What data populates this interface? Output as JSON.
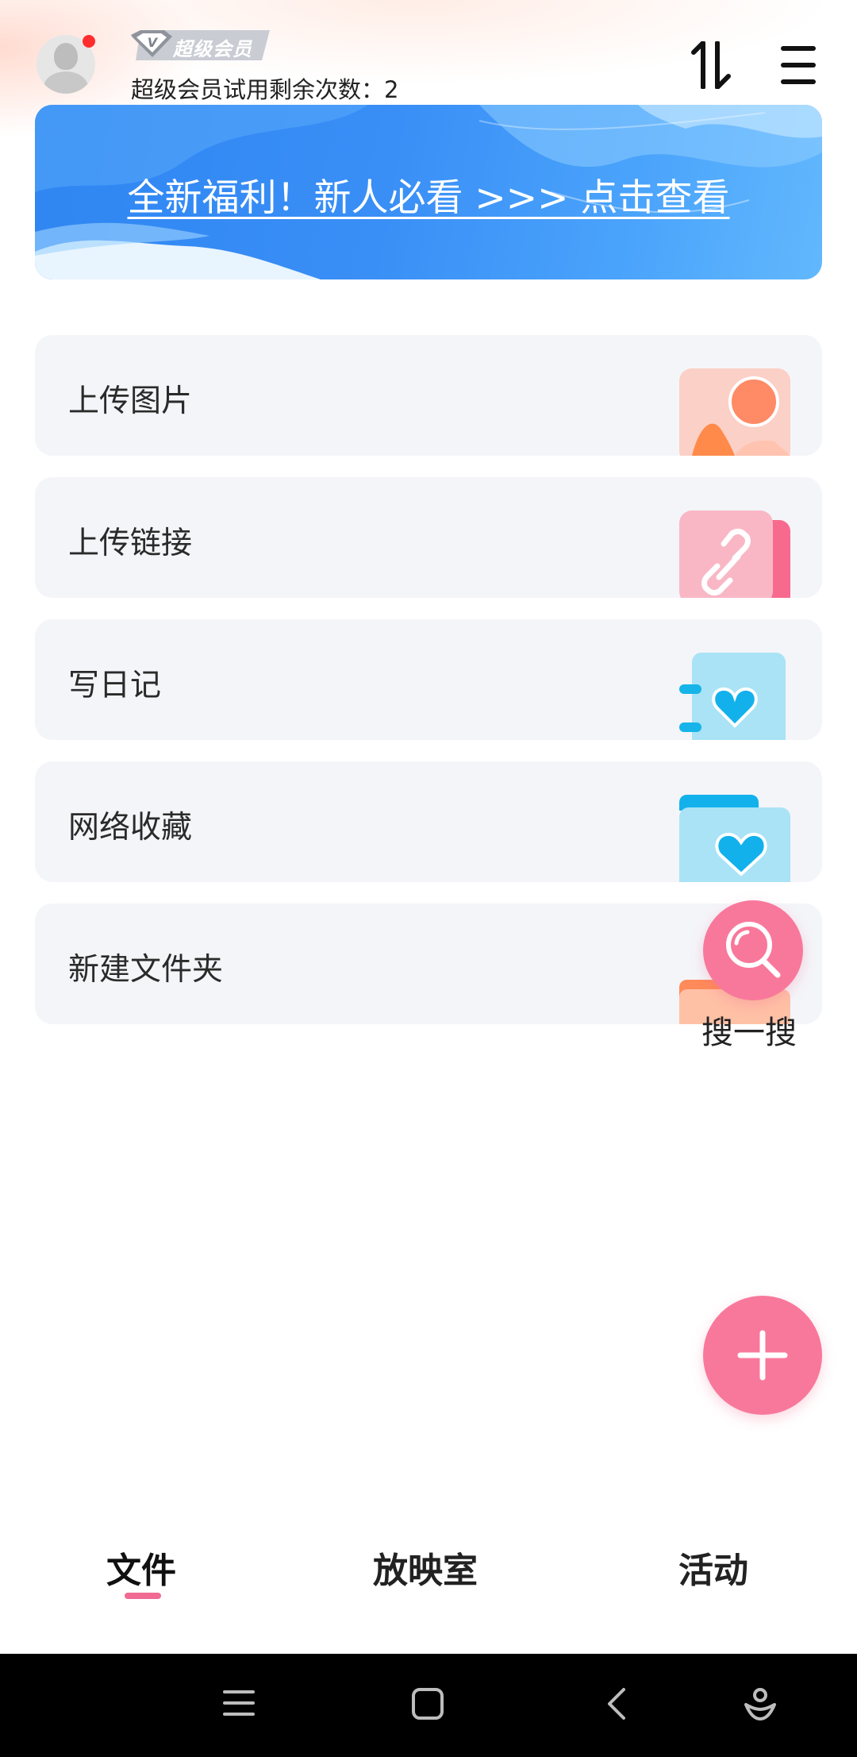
{
  "header": {
    "vip_badge_label": "超级会员",
    "vip_badge_letter": "V",
    "trial_text": "超级会员试用剩余次数：2",
    "avatar_icon": "user-avatar",
    "sort_icon": "sort-icon",
    "menu_icon": "hamburger-menu-icon"
  },
  "banner": {
    "text": "全新福利！新人必看 >>> 点击查看"
  },
  "actions": [
    {
      "label": "上传图片",
      "icon": "image-icon"
    },
    {
      "label": "上传链接",
      "icon": "link-icon"
    },
    {
      "label": "写日记",
      "icon": "diary-heart-icon"
    },
    {
      "label": "网络收藏",
      "icon": "favorite-folder-icon"
    },
    {
      "label": "新建文件夹",
      "icon": "new-folder-icon"
    }
  ],
  "search_fab": {
    "label": "搜一搜",
    "icon": "search-icon"
  },
  "add_fab": {
    "icon": "plus-icon"
  },
  "tabs": [
    {
      "label": "文件",
      "active": true
    },
    {
      "label": "放映室",
      "active": false
    },
    {
      "label": "活动",
      "active": false
    }
  ],
  "colors": {
    "accent_pink": "#f8789b",
    "banner_blue": "#3a8ff6",
    "card_bg": "#f4f5f9"
  }
}
